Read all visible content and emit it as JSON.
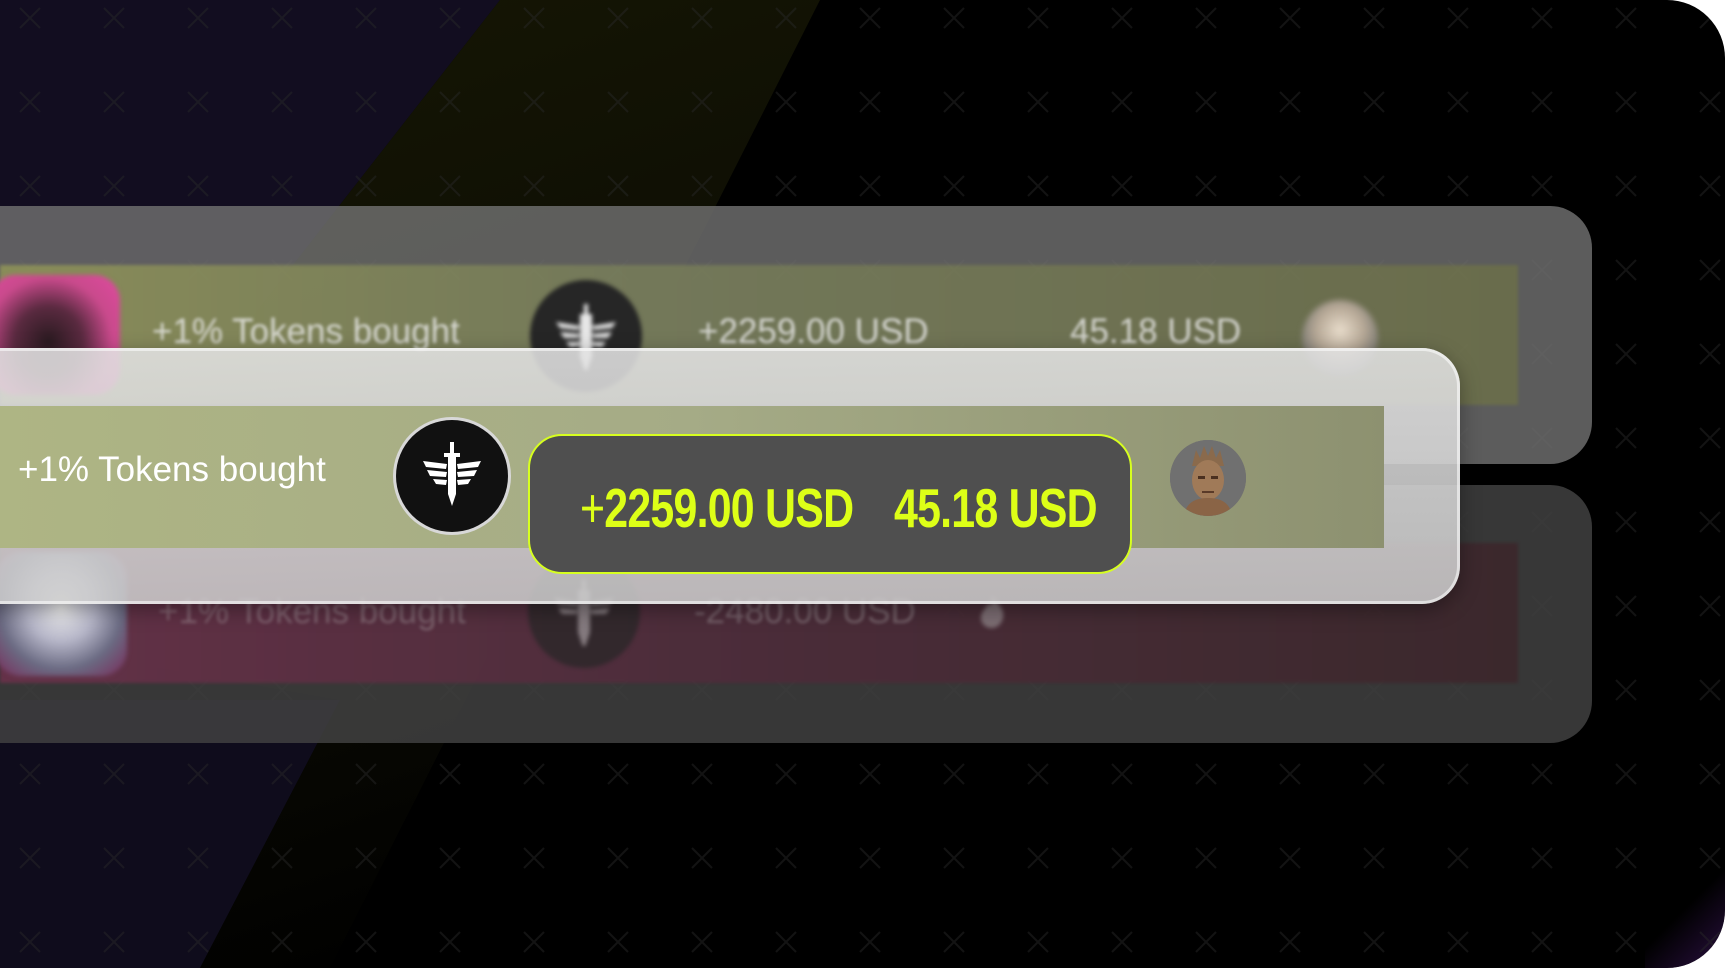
{
  "colors": {
    "accent": "#ddff17",
    "frame_bg": "#000000",
    "bought_row": "#a5ab86",
    "sold_row": "#542a3c"
  },
  "rows": [
    {
      "label": "+1% Tokens bought",
      "amount": "+2259.00 USD",
      "fee": "45.18 USD",
      "token_icon": "winged-sword-icon",
      "avatar": "user-avatar-blond"
    },
    {
      "label": "+1% Tokens bought",
      "amount_sign": "+",
      "amount_value": "2259.00 USD",
      "fee": "45.18 USD",
      "token_icon": "winged-sword-icon",
      "avatar": "user-avatar-wooden-figure"
    },
    {
      "label": "+1% Tokens bought",
      "amount": "-2480.00 USD",
      "token_icon": "winged-sword-icon",
      "avatar": "user-avatar-white-hair"
    }
  ]
}
